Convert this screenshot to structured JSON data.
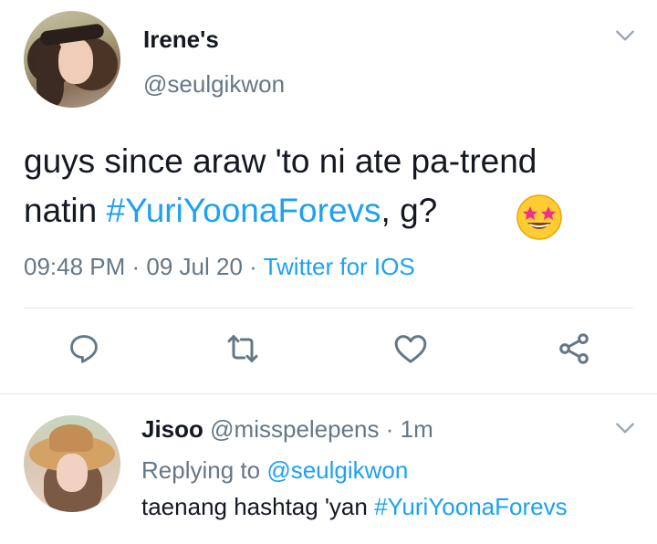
{
  "tweet": {
    "author_name": "Irene's",
    "author_handle": "@seulgikwon",
    "text_line1": "guys since araw 'to ni ate pa-trend",
    "text_line2_prefix": "natin ",
    "hashtag": "#YuriYoonaForevs",
    "text_line2_suffix": ", g?",
    "emoji": "star-struck",
    "time": "09:48 PM",
    "sep1": " · ",
    "date": "09 Jul 20",
    "sep2": " · ",
    "source": "Twitter for IOS"
  },
  "reply": {
    "author_name": "Jisoo",
    "author_handle": "@misspelepens",
    "sep": " · ",
    "age": "1m",
    "replying_prefix": "Replying to ",
    "replying_handle": "@seulgikwon",
    "text_prefix": "taenang hashtag 'yan ",
    "hashtag": "#YuriYoonaForevs"
  },
  "colors": {
    "link": "#1da1f2",
    "secondary": "#657786",
    "divider": "#e1e8ed"
  },
  "icons": [
    "chevron-down-icon",
    "reply-icon",
    "retweet-icon",
    "like-icon",
    "share-icon"
  ]
}
